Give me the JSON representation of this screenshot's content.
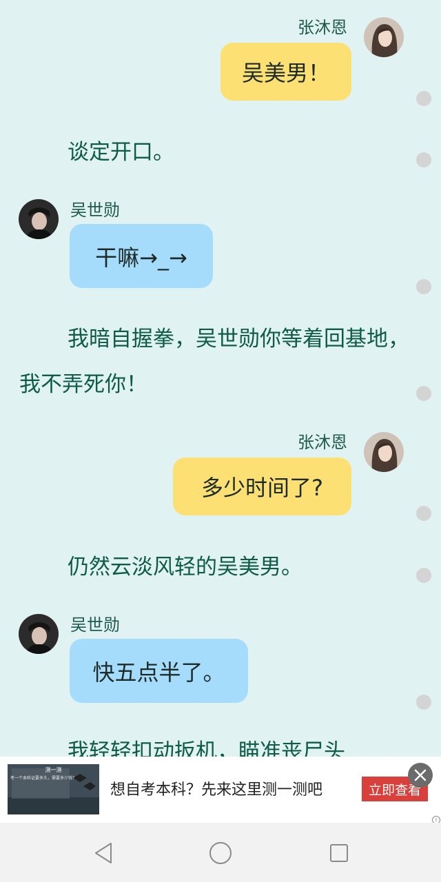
{
  "chat": {
    "me_name": "张沐恩",
    "other_name": "吴世勋",
    "messages": [
      "吴美男！",
      "谈定开口。",
      "干嘛→_→",
      "我暗自握拳，吴世勋你等着回基地，我不弄死你！",
      "多少时间了?",
      "仍然云淡风轻的吴美男。",
      "快五点半了。",
      "我轻轻扣动扳机，瞄准丧尸头"
    ]
  },
  "ad": {
    "thumb_title": "测一测",
    "thumb_subtitle": "考一个本科证要多久，需要多少钱？",
    "text": "想自考本科？先来这里测一测吧",
    "button_label": "立即查看",
    "mark": "i"
  },
  "colors": {
    "background": "#e0f2f1",
    "me_bubble": "#fde073",
    "other_bubble": "#a6dcfb",
    "narration_text": "#0e5b46",
    "ad_button": "#d9403c"
  },
  "icons": [
    "close-icon",
    "back-icon",
    "home-icon",
    "recents-icon"
  ]
}
